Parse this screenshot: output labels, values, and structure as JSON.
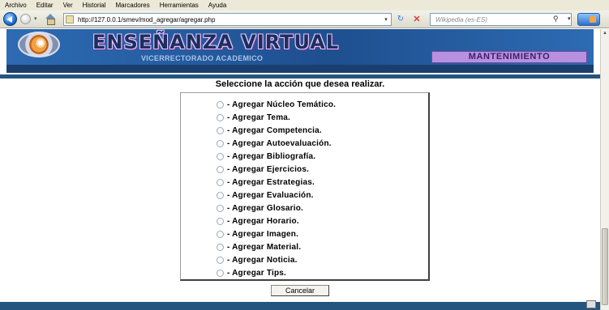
{
  "browser": {
    "menu": [
      "Archivo",
      "Editar",
      "Ver",
      "Historial",
      "Marcadores",
      "Herramientas",
      "Ayuda"
    ],
    "url": "http://127.0.0.1/smev/mod_agregar/agregar.php",
    "search_placeholder": "Wikipedia (es-ES)"
  },
  "site": {
    "title": "ENSEÑANZA VIRTUAL",
    "subtitle": "VICERRECTORADO ACADEMICO",
    "section_tag": "MANTENIMIENTO"
  },
  "form": {
    "prompt": "Seleccione la acción que desea realizar.",
    "options": [
      "- Agregar Núcleo Temático.",
      "- Agregar Tema.",
      "- Agregar Competencia.",
      "- Agregar Autoevaluación.",
      "- Agregar Bibliografía.",
      "- Agregar Ejercicios.",
      "- Agregar Estrategias.",
      "- Agregar Evaluación.",
      "- Agregar Glosario.",
      "- Agregar Horario.",
      "- Agregar Imagen.",
      "- Agregar Material.",
      "- Agregar Noticia.",
      "- Agregar Tips."
    ],
    "cancel_label": "Cancelar"
  },
  "colors": {
    "banner": "#1e4f8f",
    "page_bar": "#24557f",
    "tag": "#b890e0"
  }
}
